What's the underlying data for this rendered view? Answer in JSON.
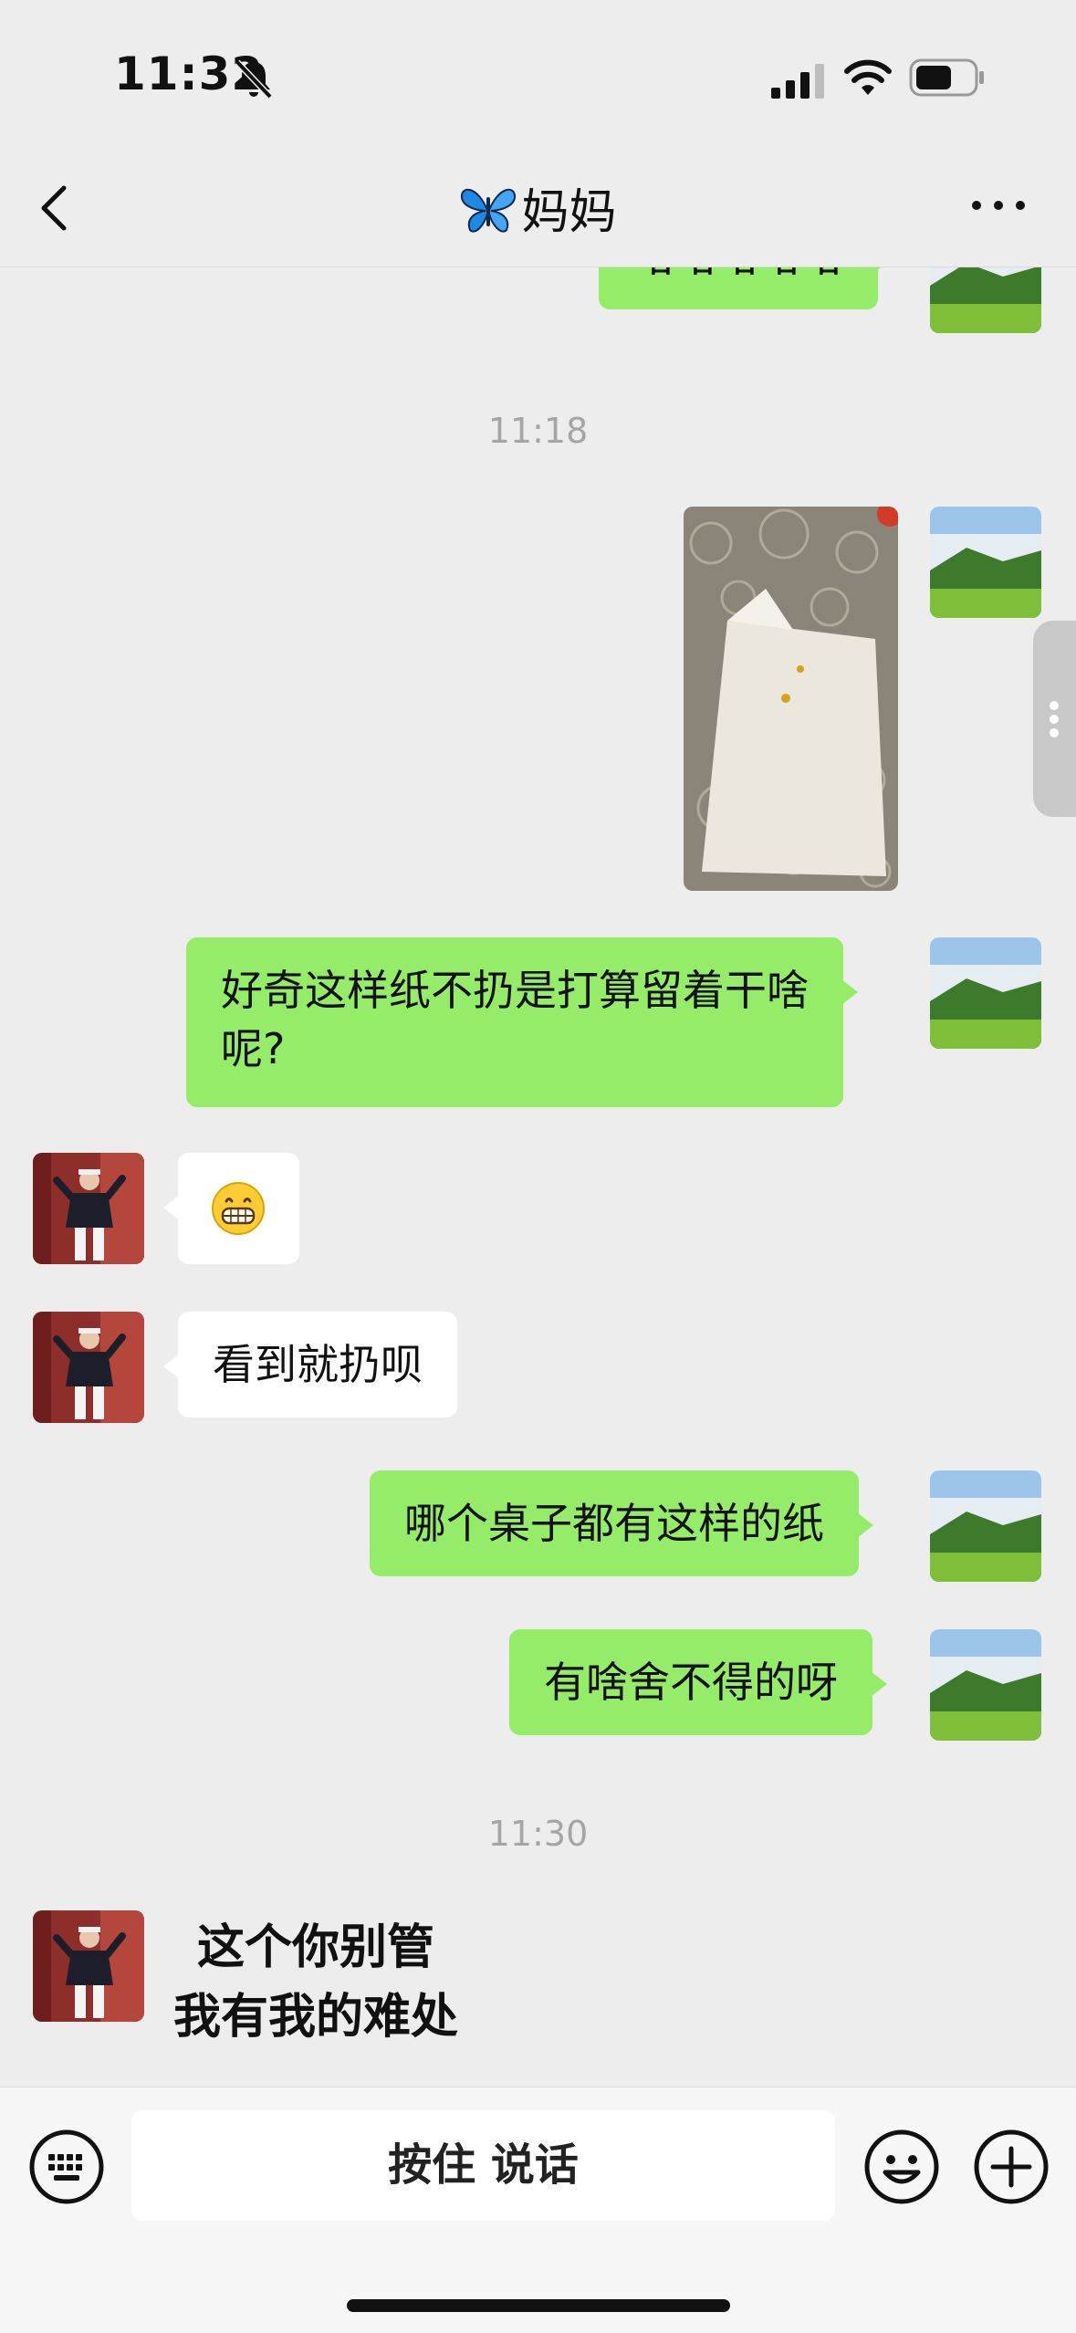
{
  "status_bar": {
    "time": "11:32"
  },
  "nav": {
    "title": "妈妈",
    "title_icon": "butterfly-icon",
    "back_icon": "chevron-left-icon",
    "more_icon": "ellipsis-icon"
  },
  "messages": [
    {
      "type": "text",
      "sender": "me",
      "text": "哈哈哈哈哈"
    },
    {
      "type": "timestamp",
      "text": "11:18"
    },
    {
      "type": "image",
      "sender": "me"
    },
    {
      "type": "text",
      "sender": "me",
      "lines": [
        "好奇这样纸不扔是打算留着干啥",
        "呢?"
      ]
    },
    {
      "type": "emoji",
      "sender": "mom",
      "text": "😁"
    },
    {
      "type": "text",
      "sender": "mom",
      "text": "看到就扔呗"
    },
    {
      "type": "text",
      "sender": "me",
      "text": "哪个桌子都有这样的纸"
    },
    {
      "type": "text",
      "sender": "me",
      "text": "有啥舍不得的呀"
    },
    {
      "type": "timestamp",
      "text": "11:30"
    },
    {
      "type": "sticker",
      "sender": "mom",
      "lines": [
        "这个你别管",
        "我有我的难处"
      ]
    }
  ],
  "input_bar": {
    "voice_label": "按住 说话",
    "left_icon": "keyboard-icon",
    "emoji_icon": "smiley-icon",
    "plus_icon": "plus-circle-icon"
  },
  "colors": {
    "background": "#ededed",
    "my_bubble": "#95ec69",
    "their_bubble": "#ffffff",
    "timestamp": "#a5a5a5"
  }
}
